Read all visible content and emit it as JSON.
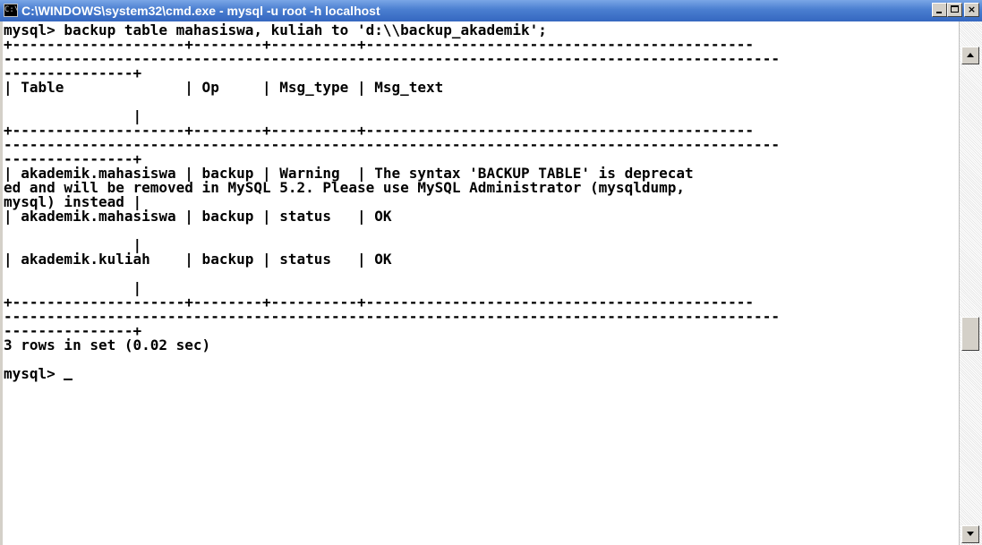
{
  "window": {
    "title": "C:\\WINDOWS\\system32\\cmd.exe - mysql -u root -h localhost",
    "icon": "cmd-icon",
    "controls": {
      "minimize": "minimize-icon",
      "maximize": "maximize-icon",
      "close_label": "×"
    }
  },
  "console": {
    "lines": [
      "mysql> backup table mahasiswa, kuliah to 'd:\\\\backup_akademik';",
      "+--------------------+--------+----------+---------------------------------------------",
      "------------------------------------------------------------------------------------------",
      "---------------+",
      "| Table              | Op     | Msg_type | Msg_text",
      "",
      "               |",
      "+--------------------+--------+----------+---------------------------------------------",
      "------------------------------------------------------------------------------------------",
      "---------------+",
      "| akademik.mahasiswa | backup | Warning  | The syntax 'BACKUP TABLE' is deprecat",
      "ed and will be removed in MySQL 5.2. Please use MySQL Administrator (mysqldump,",
      "mysql) instead |",
      "| akademik.mahasiswa | backup | status   | OK",
      "",
      "               |",
      "| akademik.kuliah    | backup | status   | OK",
      "",
      "               |",
      "+--------------------+--------+----------+---------------------------------------------",
      "------------------------------------------------------------------------------------------",
      "---------------+",
      "3 rows in set (0.02 sec)",
      "",
      "mysql> "
    ],
    "cursor": "_"
  },
  "scrollbar": {
    "up": "scroll-up-arrow-icon",
    "down": "scroll-down-arrow-icon"
  },
  "colors": {
    "titlebar": "#3567c0",
    "background": "#ffffff",
    "text": "#000000"
  }
}
